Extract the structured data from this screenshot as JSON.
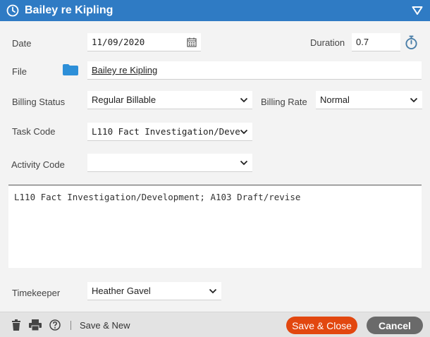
{
  "window": {
    "title": "Bailey re Kipling"
  },
  "form": {
    "date": {
      "label": "Date",
      "value": "11/09/2020"
    },
    "duration": {
      "label": "Duration",
      "value": "0.7"
    },
    "file": {
      "label": "File",
      "value": "Bailey re Kipling"
    },
    "billing_status": {
      "label": "Billing Status",
      "value": "Regular Billable"
    },
    "billing_rate": {
      "label": "Billing Rate",
      "value": "Normal"
    },
    "task_code": {
      "label": "Task Code",
      "value": "L110 Fact Investigation/Deve"
    },
    "activity_code": {
      "label": "Activity Code",
      "value": ""
    },
    "notes": {
      "value": "L110 Fact Investigation/Development; A103 Draft/revise"
    },
    "timekeeper": {
      "label": "Timekeeper",
      "value": "Heather Gavel"
    }
  },
  "footer": {
    "save_new_label": "Save & New",
    "save_close_label": "Save & Close",
    "cancel_label": "Cancel"
  },
  "icons": {
    "title": "clock-icon",
    "collapse": "triangle-down-icon",
    "date": "calendar-icon",
    "duration": "stopwatch-icon",
    "file": "folder-icon",
    "delete": "trash-icon",
    "print": "printer-icon",
    "help": "help-icon"
  },
  "colors": {
    "titlebar": "#2f7bc4",
    "folder": "#2d8fd8",
    "save_close": "#e2470f",
    "cancel": "#6a6a6a"
  }
}
